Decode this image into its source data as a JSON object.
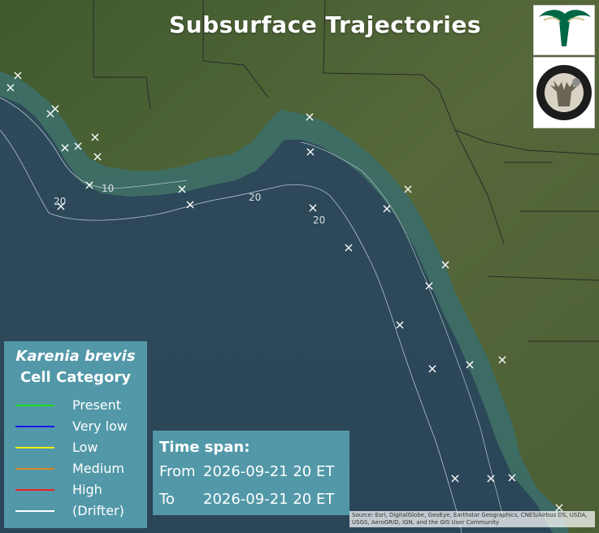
{
  "title": "Subsurface Trajectories",
  "legend": {
    "title_species": "Karenia brevis",
    "title_category": "Cell Category",
    "items": [
      {
        "label": "Present",
        "color": "#22dd22"
      },
      {
        "label": "Very low",
        "color": "#1a1aee"
      },
      {
        "label": "Low",
        "color": "#eeee11"
      },
      {
        "label": "Medium",
        "color": "#e0841a"
      },
      {
        "label": "High",
        "color": "#ee2222"
      },
      {
        "label": "(Drifter)",
        "color": "#ffffff"
      }
    ]
  },
  "timespan": {
    "label": "Time span:",
    "from_label": "From",
    "from_value": "2026-09-21 20 ET",
    "to_label": "To",
    "to_value": "2026-09-21 20 ET"
  },
  "contours": [
    {
      "label": "10",
      "color": "#b5c4cc"
    },
    {
      "label": "20",
      "color": "#b5c4cc"
    }
  ],
  "marker_symbol": "×",
  "marker_color": "#ffffff",
  "attribution": "Source: Esri, DigitalGlobe, GeoEye, Earthstar Geographics, CNES/Airbus DS, USDA, USGS, AeroGRID, IGN, and the GIS User Community",
  "logos": [
    {
      "name": "USF Bulls",
      "colors": [
        "#006747",
        "#cfc493"
      ]
    },
    {
      "name": "FWC",
      "text": "FLORIDA FISH AND WILDLIFE CONSERVATION COMMISSION"
    }
  ]
}
